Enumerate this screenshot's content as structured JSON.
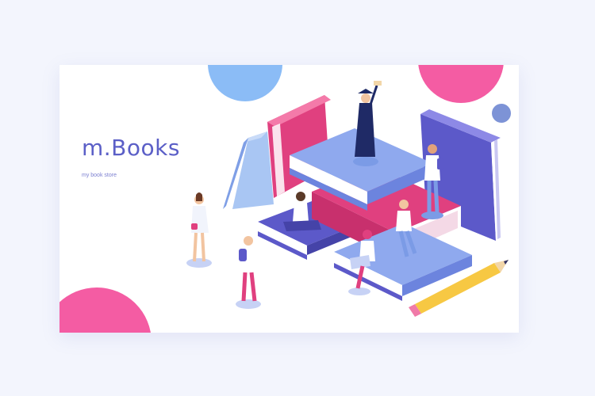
{
  "brand": {
    "title": "m.Books",
    "subtitle": "my book store"
  },
  "colors": {
    "background": "#f3f5fd",
    "card": "#ffffff",
    "brand_text": "#5b5fc7",
    "pink": "#f45ca3",
    "blue": "#8bbcf6",
    "purple": "#6e6ad6",
    "navy_dot": "#7d93d6"
  },
  "illustration": {
    "description_icon": "isometric-books-people-icon"
  }
}
